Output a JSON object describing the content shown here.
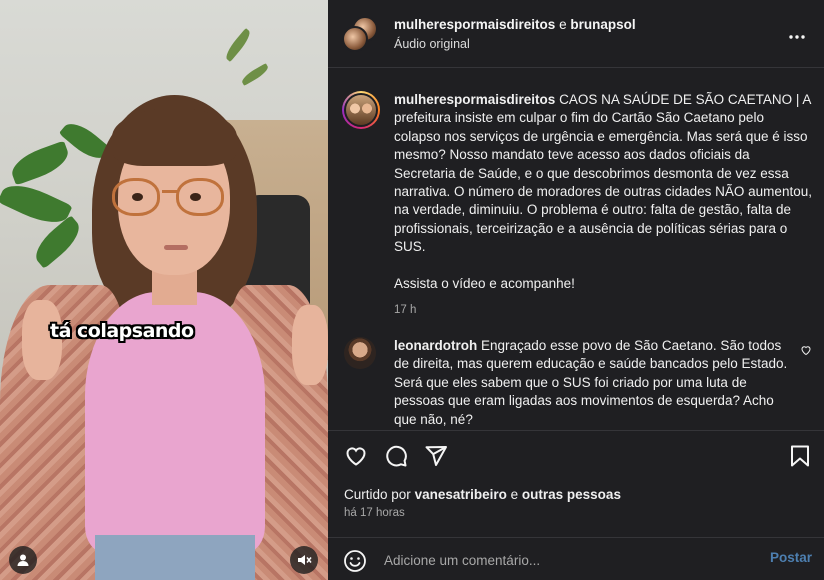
{
  "video": {
    "caption_sticker": "tá colapsando",
    "icons": {
      "profile": "person-icon",
      "audio": "muted-speaker-icon"
    }
  },
  "header": {
    "user1": "mulherespormaisdireitos",
    "connector": "e",
    "user2": "brunapsol",
    "audio_label": "Áudio original",
    "more_icon": "ellipsis-icon"
  },
  "post": {
    "username": "mulherespormaisdireitos",
    "paragraph1": "CAOS NA SAÚDE DE SÃO CAETANO | A prefeitura insiste em culpar o fim do Cartão São Caetano pelo colapso nos serviços de urgência e emergência. Mas será que é isso mesmo? Nosso mandato teve acesso aos dados oficiais da Secretaria de Saúde, e o que descobrimos desmonta de vez essa narrativa. O número de moradores de outras cidades NÃO aumentou, na verdade, diminuiu. O problema é outro: falta de gestão, falta de profissionais, terceirização e a ausência de políticas sérias para o SUS.",
    "paragraph2": "Assista o vídeo e acompanhe!",
    "time": "17 h"
  },
  "comment": {
    "username": "leonardotroh",
    "text": "Engraçado esse povo de São Caetano. São todos de direita, mas querem educação e saúde bancados pelo Estado. Será que eles sabem que o SUS foi criado por uma luta de pessoas que eram ligadas aos movimentos de esquerda? Acho que não, né?"
  },
  "actions": {
    "icons": [
      "heart-icon",
      "comment-icon",
      "share-icon",
      "bookmark-icon"
    ],
    "liked_prefix": "Curtido por",
    "liked_user": "vanesatribeiro",
    "liked_and": "e",
    "liked_others": "outras pessoas",
    "time_ago": "há 17 horas"
  },
  "comment_box": {
    "placeholder": "Adicione um comentário...",
    "post_label": "Postar"
  },
  "colors": {
    "panel_bg": "#1f1f22",
    "post_button": "#4d7fb0",
    "muted_text": "#a8a8a8"
  }
}
